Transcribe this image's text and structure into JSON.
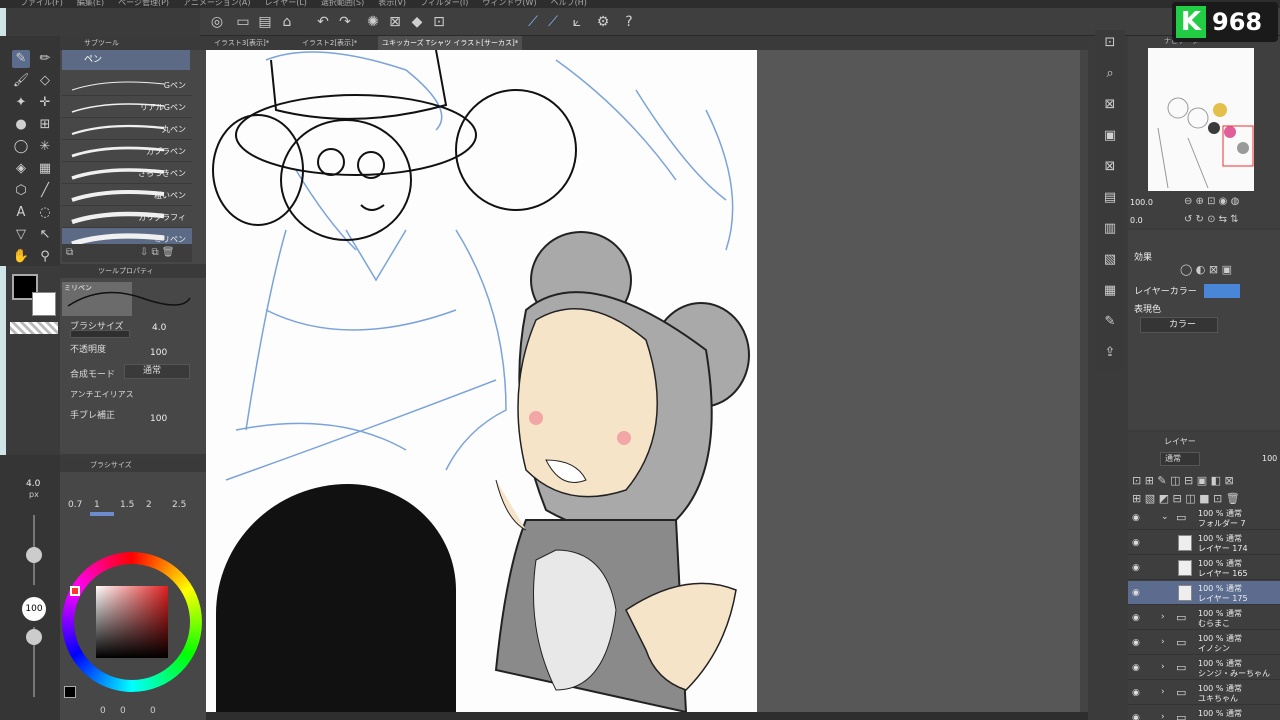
{
  "menu": [
    "ファイル(F)",
    "編集(E)",
    "ページ管理(P)",
    "アニメーション(A)",
    "レイヤー(L)",
    "選択範囲(S)",
    "表示(V)",
    "フィルター(I)",
    "ウィンドウ(W)",
    "ヘルプ(H)"
  ],
  "tabs": [
    {
      "label": "イラスト3[表示]*",
      "active": false
    },
    {
      "label": "イラスト2[表示]*",
      "active": false
    },
    {
      "label": "ユキッカーズ Tシャツ イラスト[サーカス]*",
      "active": true
    }
  ],
  "subtool": {
    "header": "サブツール",
    "active_tool": "ペン",
    "brushes": [
      {
        "label": "Gペン",
        "selected": false
      },
      {
        "label": "リアルGペン",
        "selected": false
      },
      {
        "label": "丸ペン",
        "selected": false
      },
      {
        "label": "カブラペン",
        "selected": false
      },
      {
        "label": "ざらつきペン",
        "selected": false
      },
      {
        "label": "粗いペン",
        "selected": false
      },
      {
        "label": "カリグラフィ",
        "selected": false
      },
      {
        "label": "ミリペン",
        "selected": true
      }
    ]
  },
  "toolprop": {
    "header": "ツールプロパティ",
    "brush_name": "ミリペン",
    "brush_size_label": "ブラシサイズ",
    "brush_size": "4.0",
    "opacity_label": "不透明度",
    "opacity": "100",
    "blend_label": "合成モード",
    "blend": "通常",
    "aa_label": "アンチエイリアス",
    "stabilizer_label": "手ブレ補正",
    "stabilizer": "100"
  },
  "brushsize_panel": {
    "header": "ブラシサイズ",
    "sizes": [
      "0.7",
      "1",
      "1.5",
      "2",
      "2.5"
    ],
    "selected": "1"
  },
  "leftstrip": {
    "size": "4.0",
    "size_unit": "px",
    "opacity": "100"
  },
  "statusbar": {
    "zoom": "0",
    "rotation": "0",
    "x": "0"
  },
  "navigator": {
    "header": "ナビゲーター",
    "zoom": "100.0",
    "angle": "0.0"
  },
  "effect": {
    "header": "効果",
    "layer_color_label": "レイヤーカラー",
    "layer_color": "#4a86d8",
    "expression_label": "表現色",
    "expression_value": "カラー"
  },
  "layers": {
    "header": "レイヤー",
    "blend": "通常",
    "opacity": "100",
    "items": [
      {
        "mode": "100 % 通常",
        "name": "フォルダー 7",
        "type": "folder",
        "selected": false
      },
      {
        "mode": "100 % 通常",
        "name": "レイヤー 174",
        "type": "layer",
        "selected": false
      },
      {
        "mode": "100 % 通常",
        "name": "レイヤー 165",
        "type": "layer",
        "selected": false
      },
      {
        "mode": "100 % 通常",
        "name": "レイヤー 175",
        "type": "layer",
        "selected": true
      },
      {
        "mode": "100 % 通常",
        "name": "むらまこ",
        "type": "folder",
        "selected": false
      },
      {
        "mode": "100 % 通常",
        "name": "イノシン",
        "type": "folder",
        "selected": false
      },
      {
        "mode": "100 % 通常",
        "name": "シンジ・みーちゃん",
        "type": "folder",
        "selected": false
      },
      {
        "mode": "100 % 通常",
        "name": "ユキちゃん",
        "type": "folder",
        "selected": false
      },
      {
        "mode": "100 % 通常",
        "name": "",
        "type": "folder",
        "selected": false
      }
    ]
  },
  "badge": {
    "letter": "K",
    "count": "968"
  }
}
